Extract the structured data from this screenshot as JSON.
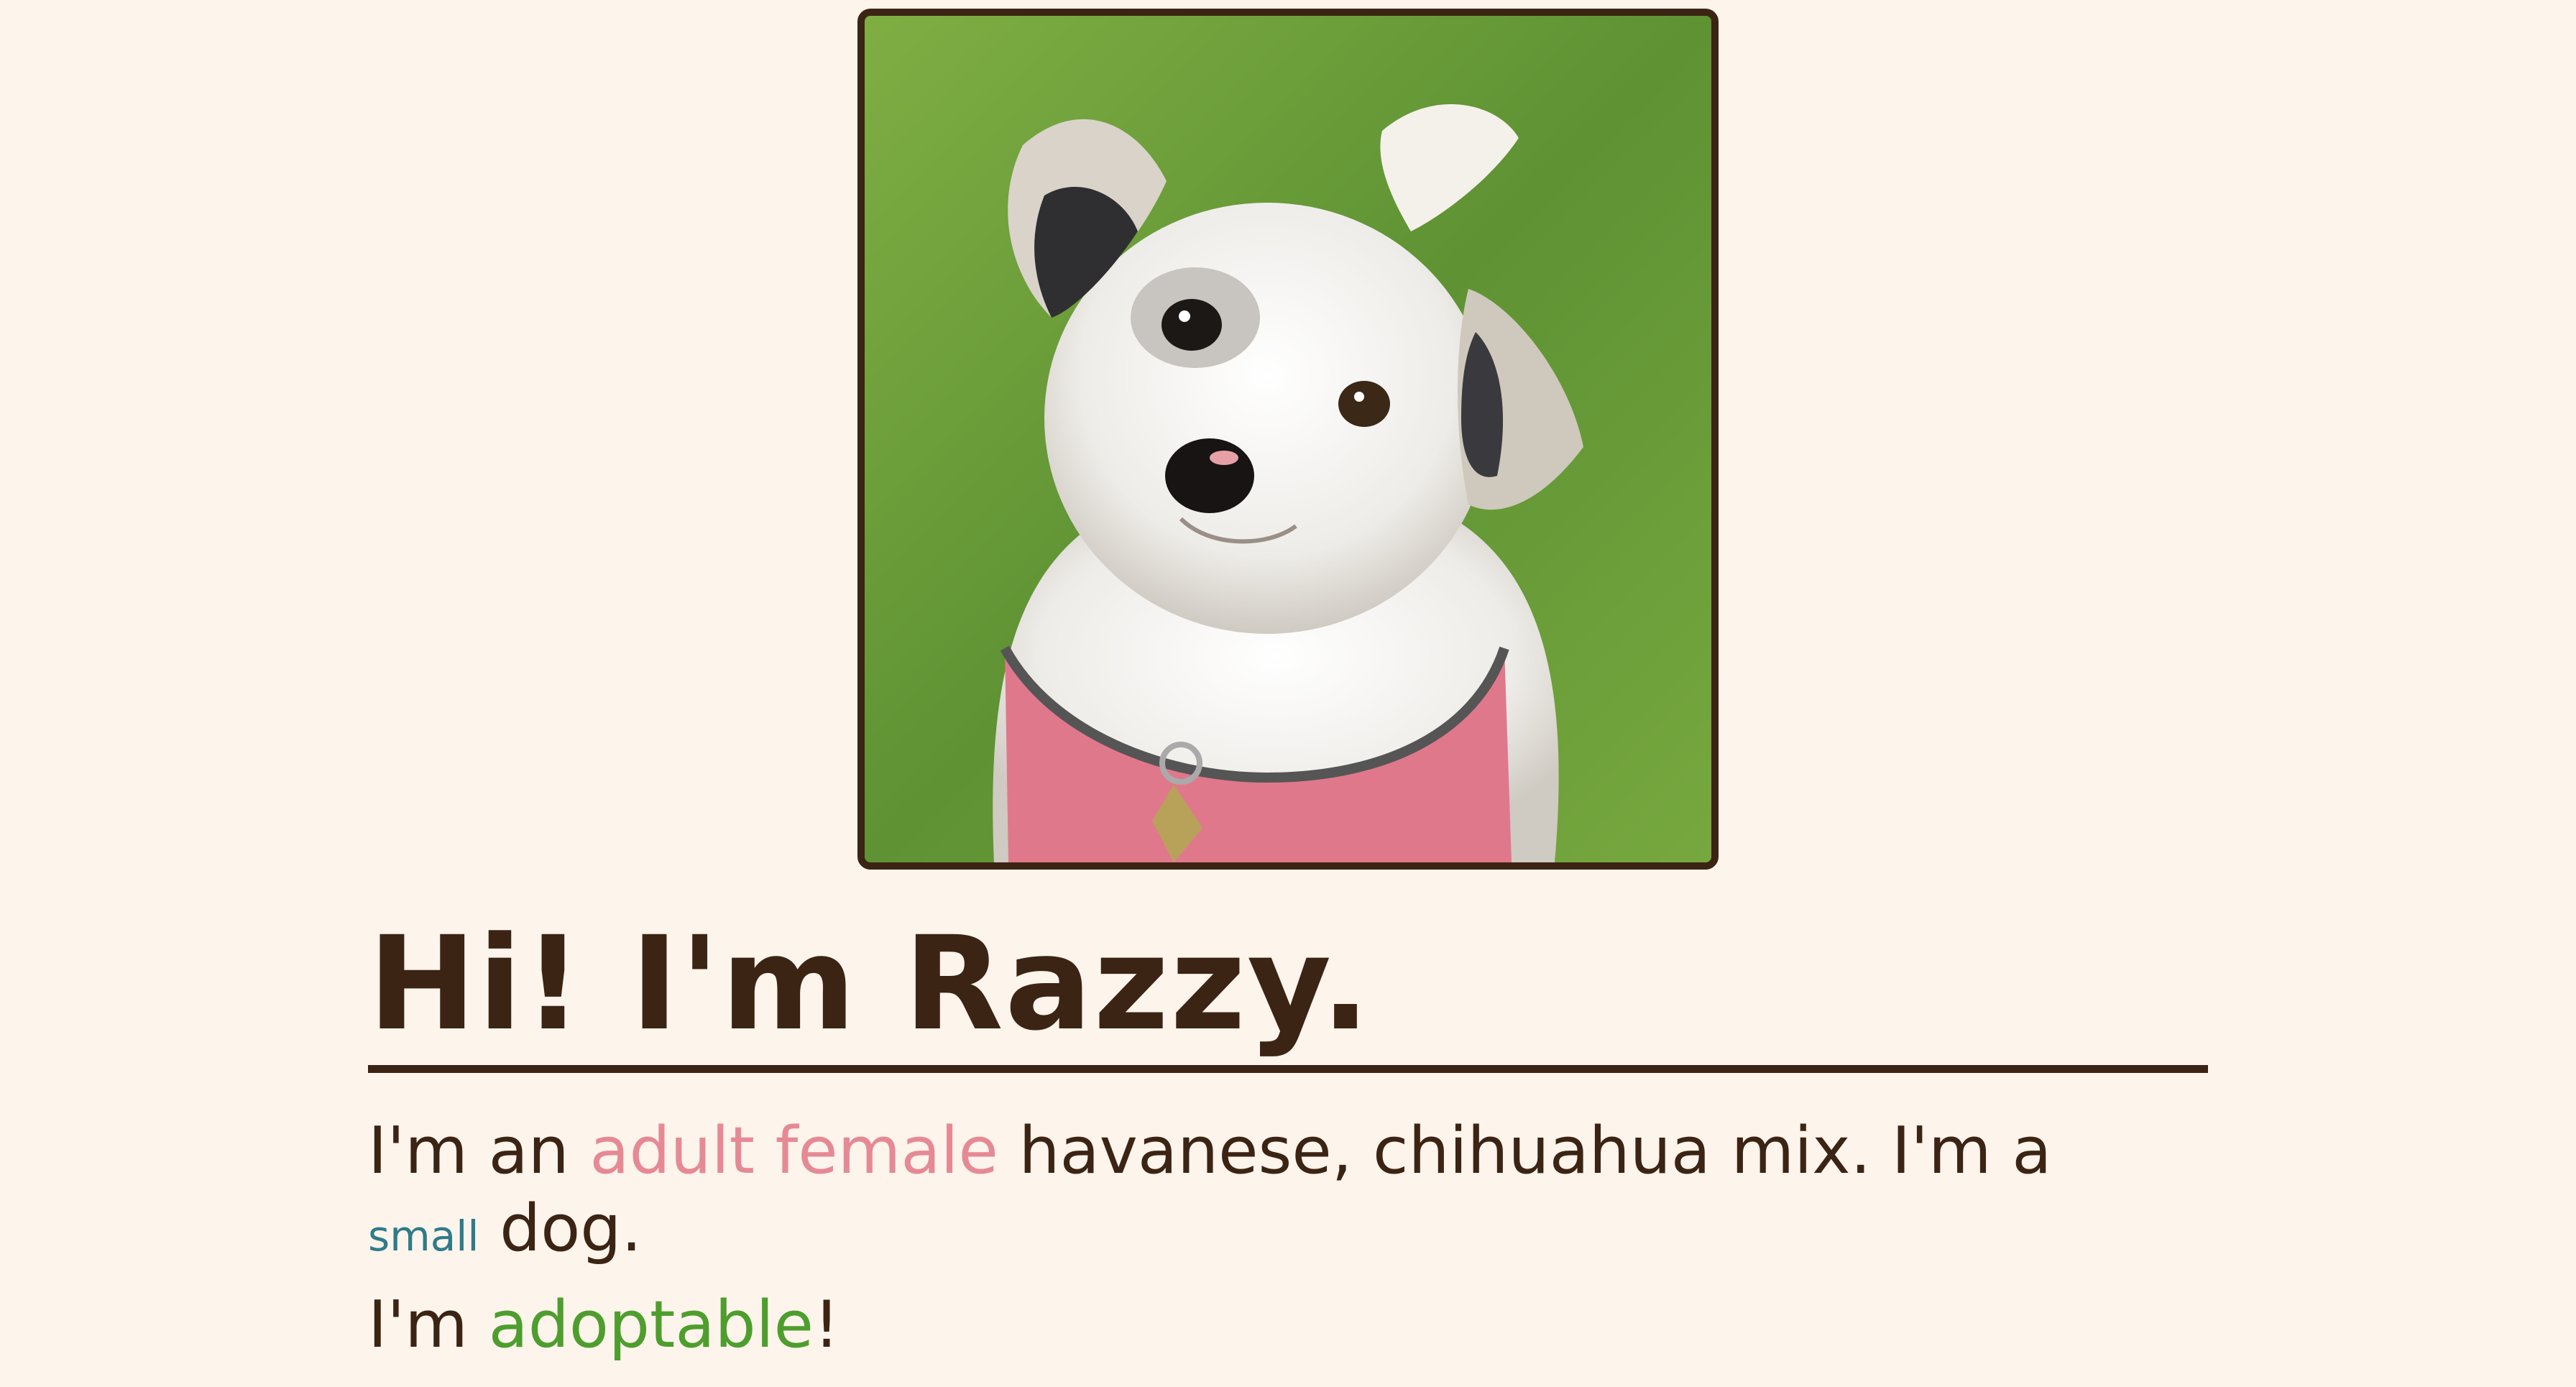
{
  "photo": {
    "subject": "dog-photo",
    "colors": {
      "grass": "#6e9e3a",
      "fur": "#f2f0ec",
      "harness": "#e0788c",
      "frame": "#3b2413"
    }
  },
  "profile": {
    "title": "Hi! I'm Razzy.",
    "desc_prefix": "I'm an ",
    "age_sex": "adult female",
    "breed_text": " havanese, chihuahua mix.  I'm a",
    "size": "small",
    "size_suffix": " dog.",
    "status_prefix": "I'm ",
    "status": "adoptable",
    "status_suffix": "!"
  },
  "theme": {
    "background": "#fdf4ec",
    "text": "#3b2413",
    "pink": "#e58a95",
    "teal": "#2f7b8a",
    "green": "#4e9e2e"
  }
}
